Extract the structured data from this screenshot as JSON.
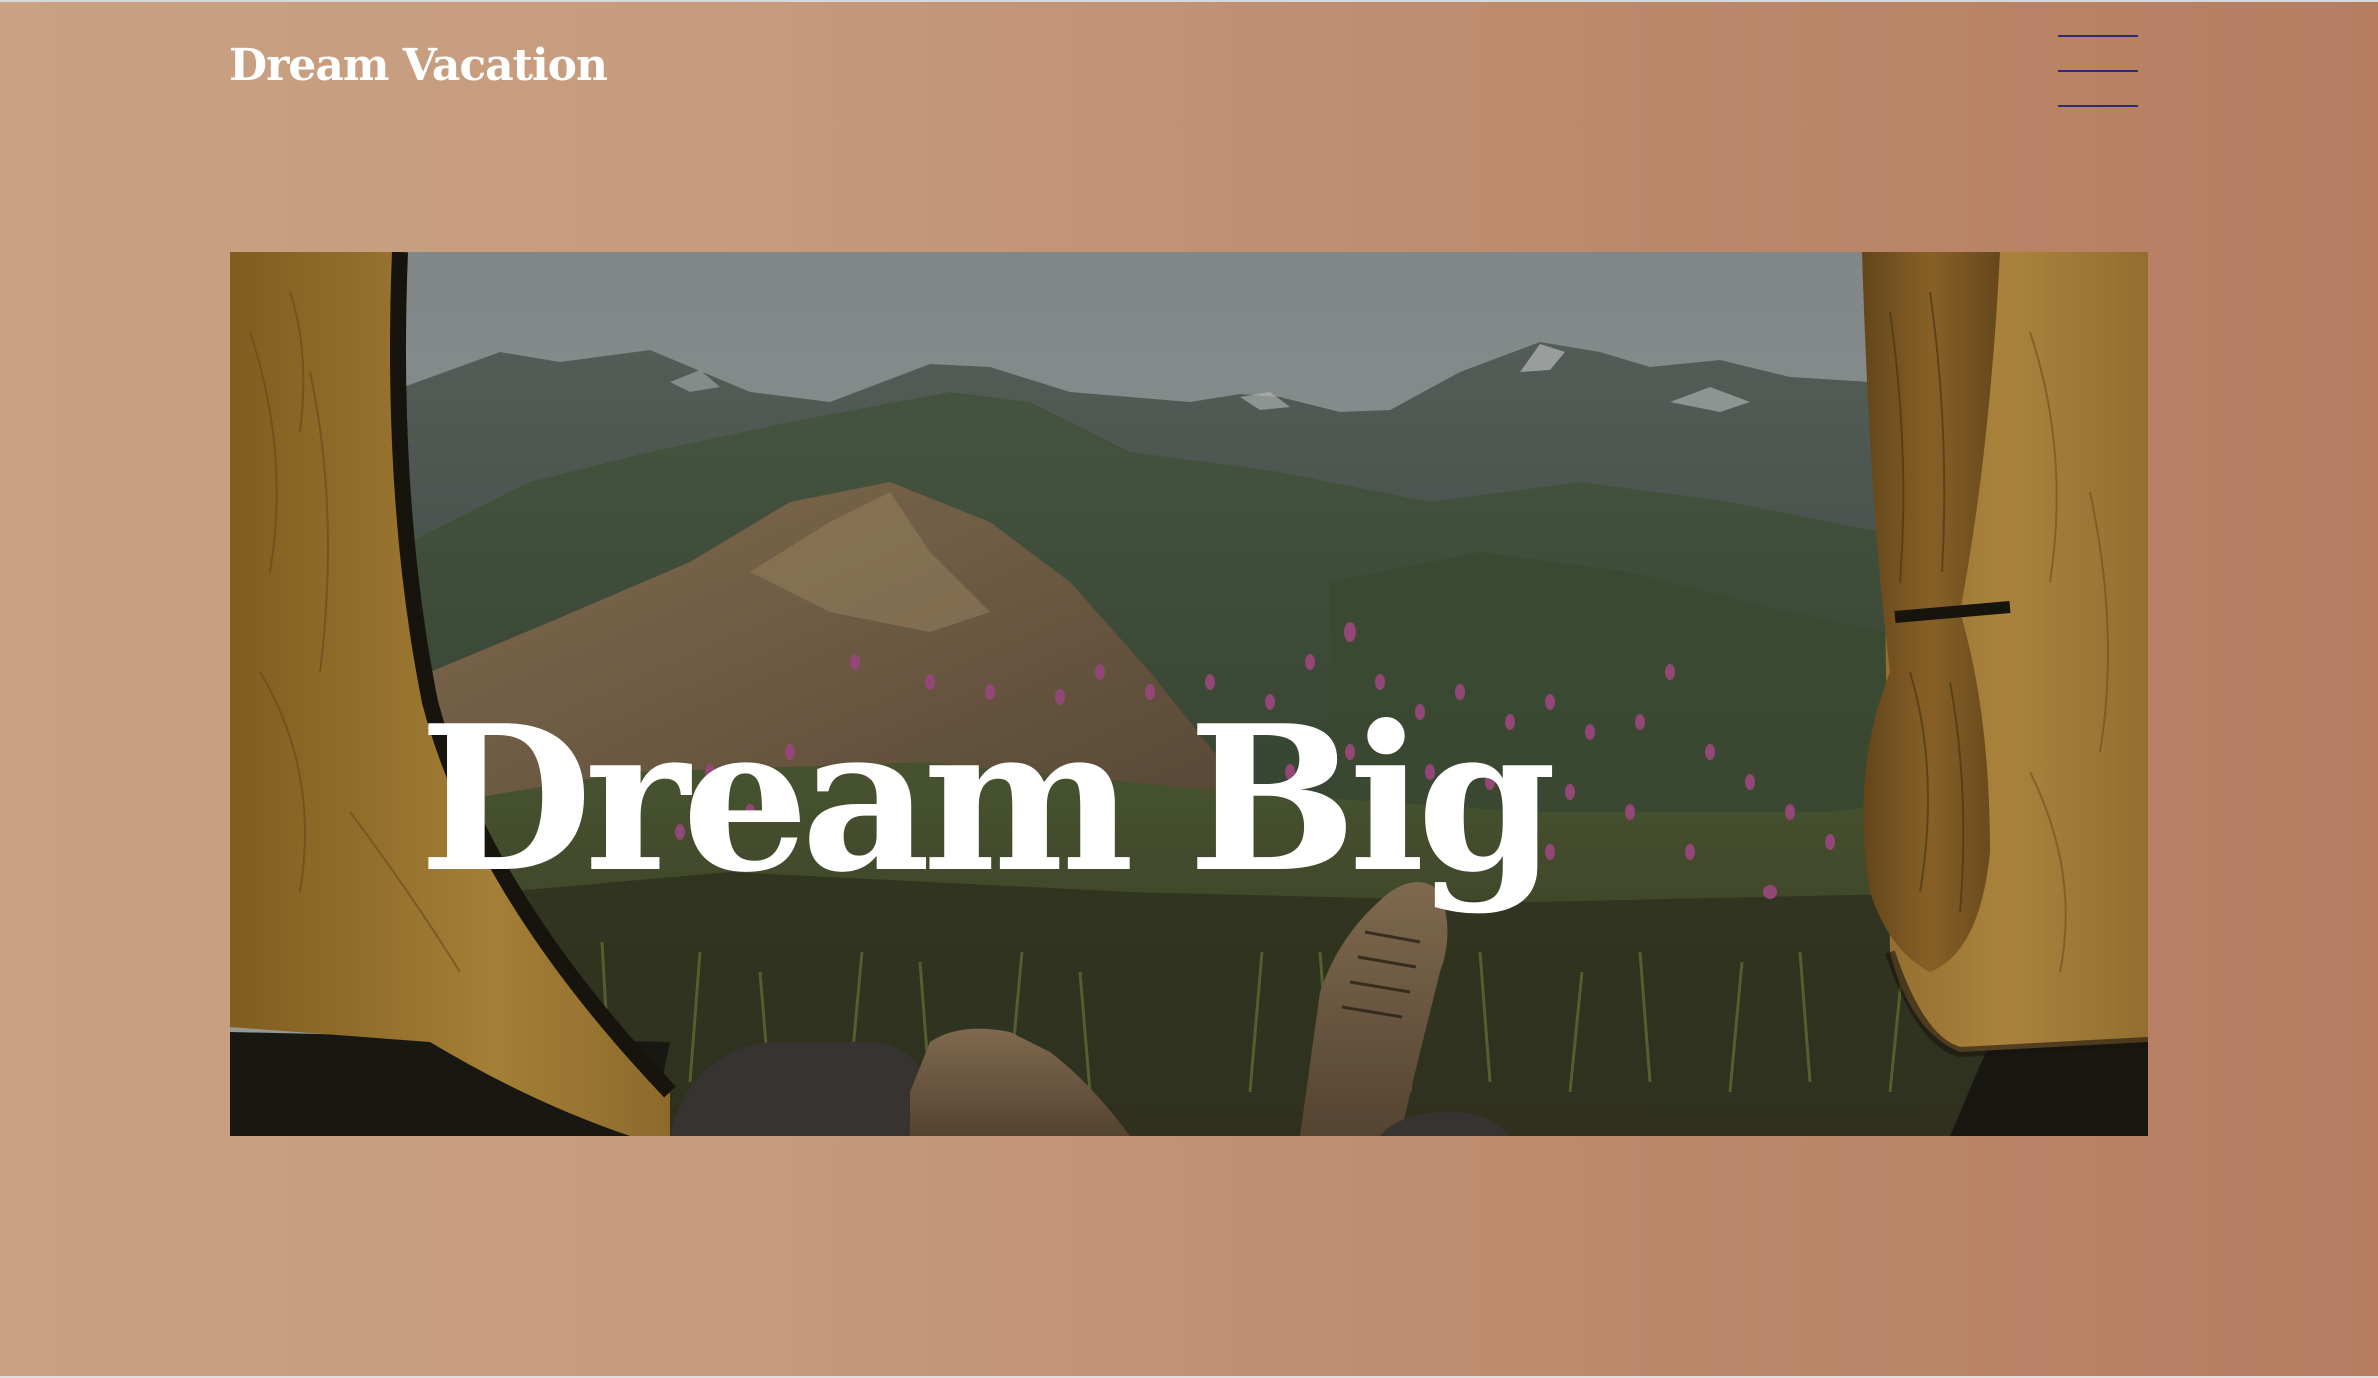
{
  "header": {
    "brand": "Dream Vacation",
    "menu_icon": "hamburger-menu-icon"
  },
  "hero": {
    "heading": "Dream Big",
    "image_subject": "view from inside a tent: mountains, wildflowers and hiking boots"
  },
  "colors": {
    "background_start": "#c9a183",
    "background_end": "#b67d61",
    "menu_lines": "#2f2a74",
    "text": "#ffffff"
  }
}
